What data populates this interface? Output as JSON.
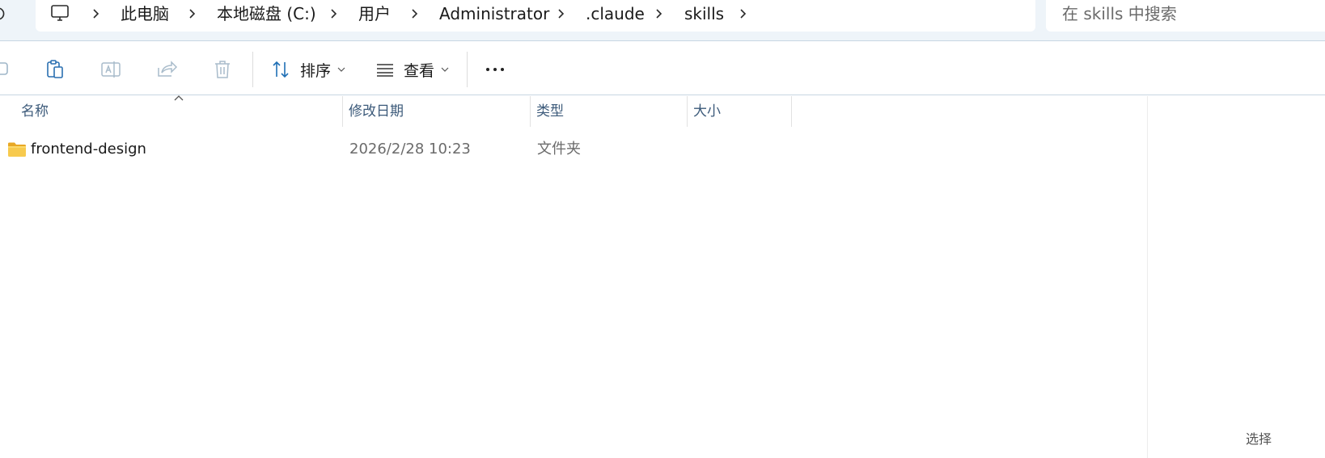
{
  "addressbar": {
    "crumbs": [
      "此电脑",
      "本地磁盘 (C:)",
      "用户",
      "Administrator",
      ".claude",
      "skills"
    ]
  },
  "search": {
    "placeholder": "在 skills 中搜索"
  },
  "toolbar": {
    "sort_label": "排序",
    "view_label": "查看"
  },
  "columns": {
    "name": "名称",
    "modified": "修改日期",
    "type": "类型",
    "size": "大小"
  },
  "files": [
    {
      "name": "frontend-design",
      "modified": "2026/2/28 10:23",
      "type": "文件夹",
      "size": ""
    }
  ],
  "statusbar": {
    "fragment": "选择"
  },
  "colors": {
    "accent": "#005fb8",
    "folder": "#f4c542",
    "header_text": "#3c5a7a"
  }
}
